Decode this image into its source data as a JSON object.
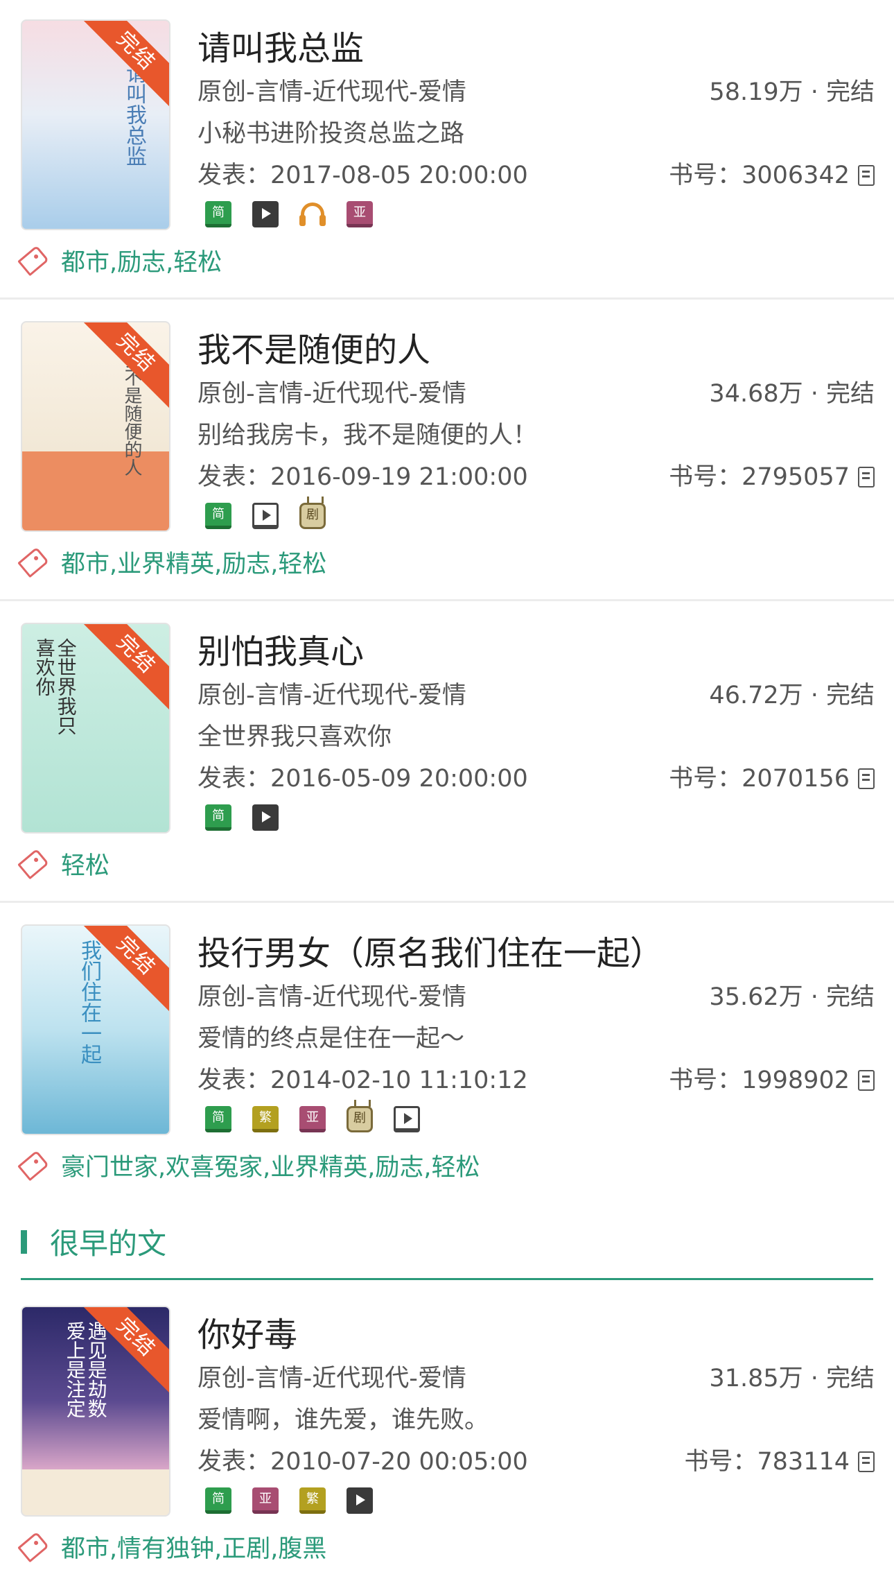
{
  "status_ribbon": "完结",
  "section_header": "很早的文",
  "bookno_prefix": "书号：",
  "pub_prefix": "发表：",
  "books": [
    {
      "title": "请叫我总监",
      "genre": "原创-言情-近代现代-爱情",
      "words_status": "58.19万 · 完结",
      "intro": "小秘书进阶投资总监之路",
      "published": "2017-08-05 20:00:00",
      "book_no": "3006342",
      "badges": [
        "简",
        "video",
        "audio",
        "亚"
      ],
      "tags": "都市,励志,轻松",
      "cover_text": "请叫我总监",
      "cover_colors": [
        "#f4d6de",
        "#b9d7ee"
      ]
    },
    {
      "title": "我不是随便的人",
      "genre": "原创-言情-近代现代-爱情",
      "words_status": "34.68万 · 完结",
      "intro": "别给我房卡，我不是随便的人！",
      "published": "2016-09-19 21:00:00",
      "book_no": "2795057",
      "badges": [
        "简",
        "play",
        "剧"
      ],
      "tags": "都市,业界精英,励志,轻松",
      "cover_text": "我不是随便的人",
      "cover_colors": [
        "#f7efe2",
        "#ec8d61"
      ]
    },
    {
      "title": "别怕我真心",
      "genre": "原创-言情-近代现代-爱情",
      "words_status": "46.72万 · 完结",
      "intro": "全世界我只喜欢你",
      "published": "2016-05-09 20:00:00",
      "book_no": "2070156",
      "badges": [
        "简",
        "video"
      ],
      "tags": "轻松",
      "cover_text": "全世界我只喜欢你",
      "cover_colors": [
        "#c8eee2",
        "#a9dfcf"
      ]
    },
    {
      "title": "投行男女（原名我们住在一起）",
      "genre": "原创-言情-近代现代-爱情",
      "words_status": "35.62万 · 完结",
      "intro": "爱情的终点是住在一起～",
      "published": "2014-02-10 11:10:12",
      "book_no": "1998902",
      "badges": [
        "简",
        "繁",
        "亚",
        "剧",
        "play"
      ],
      "tags": "豪门世家,欢喜冤家,业界精英,励志,轻松",
      "cover_text": "我们住在一起",
      "cover_colors": [
        "#d9f0f6",
        "#7fc6de"
      ]
    },
    {
      "title": "你好毒",
      "genre": "原创-言情-近代现代-爱情",
      "words_status": "31.85万 · 完结",
      "intro": "爱情啊，谁先爱，谁先败。",
      "published": "2010-07-20 00:05:00",
      "book_no": "783114",
      "badges": [
        "简",
        "亚",
        "繁",
        "video"
      ],
      "tags": "都市,情有独钟,正剧,腹黑",
      "cover_text": "遇见是劫数 爱上是注定",
      "cover_colors": [
        "#2e2a66",
        "#d9a6c8"
      ]
    }
  ]
}
